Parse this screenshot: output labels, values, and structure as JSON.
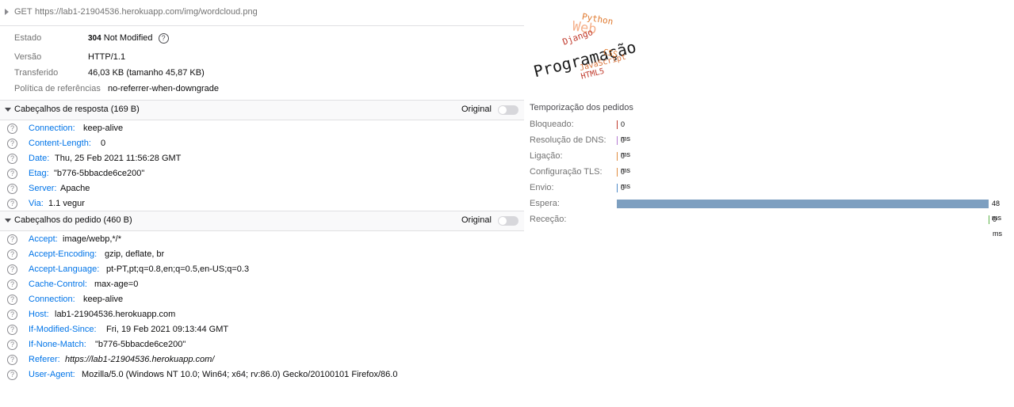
{
  "request": {
    "method": "GET",
    "url": "https://lab1-21904536.herokuapp.com/img/wordcloud.png"
  },
  "summary": {
    "status_label": "Estado",
    "status_code": "304",
    "status_text": "Not Modified",
    "version_label": "Versão",
    "version": "HTTP/1.1",
    "transferred_label": "Transferido",
    "transferred": "46,03 KB (tamanho 45,87 KB)",
    "referrer_policy_label": "Política de referências",
    "referrer_policy": "no-referrer-when-downgrade"
  },
  "response_headers": {
    "title": "Cabeçalhos de resposta (169 B)",
    "original_label": "Original",
    "items": [
      {
        "name": "Connection:",
        "value": "keep-alive"
      },
      {
        "name": "Content-Length:",
        "value": "0"
      },
      {
        "name": "Date:",
        "value": "Thu, 25 Feb 2021 11:56:28 GMT"
      },
      {
        "name": "Etag:",
        "value": "\"b776-5bbacde6ce200\""
      },
      {
        "name": "Server:",
        "value": "Apache"
      },
      {
        "name": "Via:",
        "value": "1.1 vegur"
      }
    ]
  },
  "request_headers": {
    "title": "Cabeçalhos do pedido (460 B)",
    "original_label": "Original",
    "items": [
      {
        "name": "Accept:",
        "value": "image/webp,*/*"
      },
      {
        "name": "Accept-Encoding:",
        "value": "gzip, deflate, br"
      },
      {
        "name": "Accept-Language:",
        "value": "pt-PT,pt;q=0.8,en;q=0.5,en-US;q=0.3"
      },
      {
        "name": "Cache-Control:",
        "value": "max-age=0"
      },
      {
        "name": "Connection:",
        "value": "keep-alive"
      },
      {
        "name": "Host:",
        "value": "lab1-21904536.herokuapp.com"
      },
      {
        "name": "If-Modified-Since:",
        "value": "Fri, 19 Feb 2021 09:13:44 GMT"
      },
      {
        "name": "If-None-Match:",
        "value": "\"b776-5bbacde6ce200\""
      },
      {
        "name": "Referer:",
        "value": "https://lab1-21904536.herokuapp.com/"
      },
      {
        "name": "User-Agent:",
        "value": "Mozilla/5.0 (Windows NT 10.0; Win64; x64; rv:86.0) Gecko/20100101 Firefox/86.0"
      }
    ]
  },
  "preview_wordcloud": {
    "words": [
      "Python",
      "Web",
      "Django",
      "Programação",
      "CSS",
      "JavaScript",
      "HTML5"
    ]
  },
  "timings": {
    "title": "Temporização dos pedidos",
    "rows": [
      {
        "label": "Bloqueado:",
        "value": "0 ms",
        "color": "#c0392b"
      },
      {
        "label": "Resolução de DNS:",
        "value": "0 ms",
        "color": "#b47bd1"
      },
      {
        "label": "Ligação:",
        "value": "0 ms",
        "color": "#e08b3f"
      },
      {
        "label": "Configuração TLS:",
        "value": "0 ms",
        "color": "#e08b3f"
      },
      {
        "label": "Envio:",
        "value": "0 ms",
        "color": "#4d8ac7"
      },
      {
        "label": "Espera:",
        "value": "48 ms",
        "color": "#7d9fc0"
      },
      {
        "label": "Receção:",
        "value": "0 ms",
        "color": "#5fb34a"
      }
    ]
  }
}
